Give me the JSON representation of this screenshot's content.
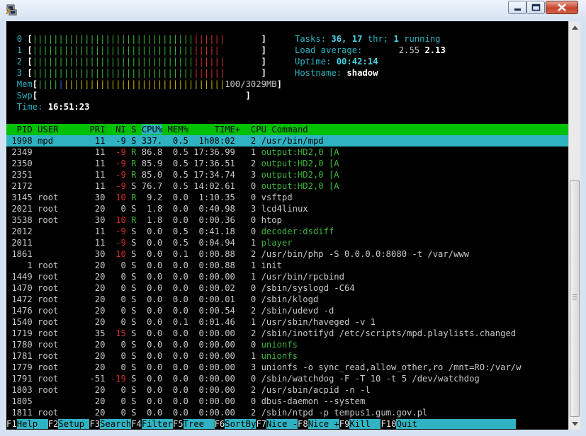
{
  "cpu_meters": [
    {
      "label": "0",
      "green": "|||||||||||||||||||||||||||||||",
      "red": "||||||"
    },
    {
      "label": "1",
      "green": "|||||||||||||||||||||||||||||||",
      "red": "|||||"
    },
    {
      "label": "2",
      "green": "|||||||||||||||||||||||||||||||",
      "red": "||||||"
    },
    {
      "label": "3",
      "green": "|||||||||||||||||||||||||||||||",
      "red": "||||||"
    }
  ],
  "mem_meter": {
    "label": "Mem",
    "bars_green": "||||",
    "bars_blue": "|",
    "bars_yellow": "|||||||||||||||||||||||||||||||",
    "value": "100/3029MB"
  },
  "swp_meter": {
    "label": "Swp"
  },
  "time": {
    "label": "Time:",
    "value": "16:51:23"
  },
  "tasks": {
    "label": "Tasks:",
    "count": "36,",
    "thr": "17",
    "thr_label": "thr;",
    "running": "1",
    "running_label": "running"
  },
  "load": {
    "label": "Load average:",
    "v1": "2.55",
    "v2": "2.13"
  },
  "uptime": {
    "label": "Uptime:",
    "value": "00:42:14"
  },
  "hostname": {
    "label": "Hostname:",
    "value": "shadow"
  },
  "columns": {
    "pid": "PID",
    "user": "USER",
    "pri": "PRI",
    "ni": "NI",
    "s": "S",
    "cpu": "CPU%",
    "mem": "MEM%",
    "time": "TIME+",
    "cpu_n": "CPU",
    "command": "Command"
  },
  "processes": [
    {
      "pid": "1998",
      "user": "mpd",
      "pri": "11",
      "ni": "-9",
      "s": "S",
      "cpu": "337.",
      "mem": "0.5",
      "time": "1h08:02",
      "cpun": "2",
      "cmd": "/usr/bin/mpd",
      "kind": "selected"
    },
    {
      "pid": "2349",
      "user": "",
      "pri": "11",
      "ni": "-9",
      "s": "R",
      "cpu": "86.8",
      "mem": "0.5",
      "time": "17:36.99",
      "cpun": "1",
      "cmd": "output:HD2,0 [A",
      "kind": "thread"
    },
    {
      "pid": "2350",
      "user": "",
      "pri": "11",
      "ni": "-9",
      "s": "R",
      "cpu": "85.9",
      "mem": "0.5",
      "time": "17:36.51",
      "cpun": "2",
      "cmd": "output:HD2,0 [A",
      "kind": "thread"
    },
    {
      "pid": "2351",
      "user": "",
      "pri": "11",
      "ni": "-9",
      "s": "R",
      "cpu": "85.0",
      "mem": "0.5",
      "time": "17:34.74",
      "cpun": "3",
      "cmd": "output:HD2,0 [A",
      "kind": "thread"
    },
    {
      "pid": "2172",
      "user": "",
      "pri": "11",
      "ni": "-9",
      "s": "S",
      "cpu": "76.7",
      "mem": "0.5",
      "time": "14:02.61",
      "cpun": "0",
      "cmd": "output:HD2,0 [A",
      "kind": "thread"
    },
    {
      "pid": "3145",
      "user": "root",
      "pri": "30",
      "ni": "10",
      "s": "R",
      "cpu": "9.2",
      "mem": "0.0",
      "time": "1:10.35",
      "cpun": "0",
      "cmd": "vsftpd",
      "kind": "proc"
    },
    {
      "pid": "2021",
      "user": "root",
      "pri": "20",
      "ni": "0",
      "s": "S",
      "cpu": "1.8",
      "mem": "0.0",
      "time": "0:40.98",
      "cpun": "3",
      "cmd": "lcd4linux",
      "kind": "proc"
    },
    {
      "pid": "3538",
      "user": "root",
      "pri": "30",
      "ni": "10",
      "s": "R",
      "cpu": "1.8",
      "mem": "0.0",
      "time": "0:00.36",
      "cpun": "0",
      "cmd": "htop",
      "kind": "proc"
    },
    {
      "pid": "2012",
      "user": "",
      "pri": "11",
      "ni": "-9",
      "s": "S",
      "cpu": "0.0",
      "mem": "0.5",
      "time": "0:41.18",
      "cpun": "0",
      "cmd": "decoder:dsdiff",
      "kind": "thread"
    },
    {
      "pid": "2011",
      "user": "",
      "pri": "11",
      "ni": "-9",
      "s": "S",
      "cpu": "0.0",
      "mem": "0.5",
      "time": "0:04.94",
      "cpun": "1",
      "cmd": "player",
      "kind": "thread"
    },
    {
      "pid": "1861",
      "user": "",
      "pri": "30",
      "ni": "10",
      "s": "S",
      "cpu": "0.0",
      "mem": "0.1",
      "time": "0:00.88",
      "cpun": "2",
      "cmd": "/usr/bin/php -S 0.0.0.0:8080 -t /var/www",
      "kind": "proc"
    },
    {
      "pid": "1",
      "user": "root",
      "pri": "20",
      "ni": "0",
      "s": "S",
      "cpu": "0.0",
      "mem": "0.0",
      "time": "0:00.88",
      "cpun": "1",
      "cmd": "init",
      "kind": "proc"
    },
    {
      "pid": "1449",
      "user": "root",
      "pri": "20",
      "ni": "0",
      "s": "S",
      "cpu": "0.0",
      "mem": "0.0",
      "time": "0:00.00",
      "cpun": "1",
      "cmd": "/usr/bin/rpcbind",
      "kind": "proc"
    },
    {
      "pid": "1470",
      "user": "root",
      "pri": "20",
      "ni": "0",
      "s": "S",
      "cpu": "0.0",
      "mem": "0.0",
      "time": "0:00.02",
      "cpun": "0",
      "cmd": "/sbin/syslogd -C64",
      "kind": "proc"
    },
    {
      "pid": "1472",
      "user": "root",
      "pri": "20",
      "ni": "0",
      "s": "S",
      "cpu": "0.0",
      "mem": "0.0",
      "time": "0:00.01",
      "cpun": "0",
      "cmd": "/sbin/klogd",
      "kind": "proc"
    },
    {
      "pid": "1476",
      "user": "root",
      "pri": "20",
      "ni": "0",
      "s": "S",
      "cpu": "0.0",
      "mem": "0.0",
      "time": "0:00.54",
      "cpun": "2",
      "cmd": "/sbin/udevd -d",
      "kind": "proc"
    },
    {
      "pid": "1540",
      "user": "root",
      "pri": "20",
      "ni": "0",
      "s": "S",
      "cpu": "0.0",
      "mem": "0.1",
      "time": "0:01.46",
      "cpun": "1",
      "cmd": "/usr/sbin/haveged -v 1",
      "kind": "proc"
    },
    {
      "pid": "1719",
      "user": "root",
      "pri": "35",
      "ni": "15",
      "s": "S",
      "cpu": "0.0",
      "mem": "0.0",
      "time": "0:00.00",
      "cpun": "2",
      "cmd": "/sbin/inotifyd /etc/scripts/mpd.playlists.changed",
      "kind": "proc"
    },
    {
      "pid": "1780",
      "user": "root",
      "pri": "20",
      "ni": "0",
      "s": "S",
      "cpu": "0.0",
      "mem": "0.0",
      "time": "0:00.00",
      "cpun": "0",
      "cmd": "unionfs",
      "kind": "thread"
    },
    {
      "pid": "1781",
      "user": "root",
      "pri": "20",
      "ni": "0",
      "s": "S",
      "cpu": "0.0",
      "mem": "0.0",
      "time": "0:00.00",
      "cpun": "1",
      "cmd": "unionfs",
      "kind": "thread"
    },
    {
      "pid": "1779",
      "user": "root",
      "pri": "20",
      "ni": "0",
      "s": "S",
      "cpu": "0.0",
      "mem": "0.0",
      "time": "0:00.00",
      "cpun": "3",
      "cmd": "unionfs -o sync_read,allow_other,ro /mnt=RO:/var/w",
      "kind": "proc"
    },
    {
      "pid": "1791",
      "user": "root",
      "pri": "-51",
      "ni": "-19",
      "s": "S",
      "cpu": "0.0",
      "mem": "0.0",
      "time": "0:00.00",
      "cpun": "0",
      "cmd": "/sbin/watchdog -F -T 10 -t 5 /dev/watchdog",
      "kind": "proc"
    },
    {
      "pid": "1803",
      "user": "root",
      "pri": "20",
      "ni": "0",
      "s": "S",
      "cpu": "0.0",
      "mem": "0.0",
      "time": "0:00.00",
      "cpun": "2",
      "cmd": "/usr/sbin/acpid -n -l",
      "kind": "proc"
    },
    {
      "pid": "1805",
      "user": "",
      "pri": "20",
      "ni": "0",
      "s": "S",
      "cpu": "0.0",
      "mem": "0.0",
      "time": "0:00.00",
      "cpun": "0",
      "cmd": "dbus-daemon --system",
      "kind": "proc"
    },
    {
      "pid": "1811",
      "user": "root",
      "pri": "20",
      "ni": "0",
      "s": "S",
      "cpu": "0.0",
      "mem": "0.0",
      "time": "0:00.00",
      "cpun": "2",
      "cmd": "/sbin/ntpd -p tempus1.gum.gov.pl",
      "kind": "proc"
    }
  ],
  "function_keys": [
    {
      "key": "F1",
      "label": "Help  "
    },
    {
      "key": "F2",
      "label": "Setup "
    },
    {
      "key": "F3",
      "label": "Search"
    },
    {
      "key": "F4",
      "label": "Filter"
    },
    {
      "key": "F5",
      "label": "Tree  "
    },
    {
      "key": "F6",
      "label": "SortBy"
    },
    {
      "key": "F7",
      "label": "Nice -"
    },
    {
      "key": "F8",
      "label": "Nice +"
    },
    {
      "key": "F9",
      "label": "Kill  "
    },
    {
      "key": "F10",
      "label": "Quit                   "
    }
  ],
  "colors": {
    "header_bg": "#00c000",
    "selected_bg": "#2fb3c2",
    "terminal_bg": "#000000"
  }
}
